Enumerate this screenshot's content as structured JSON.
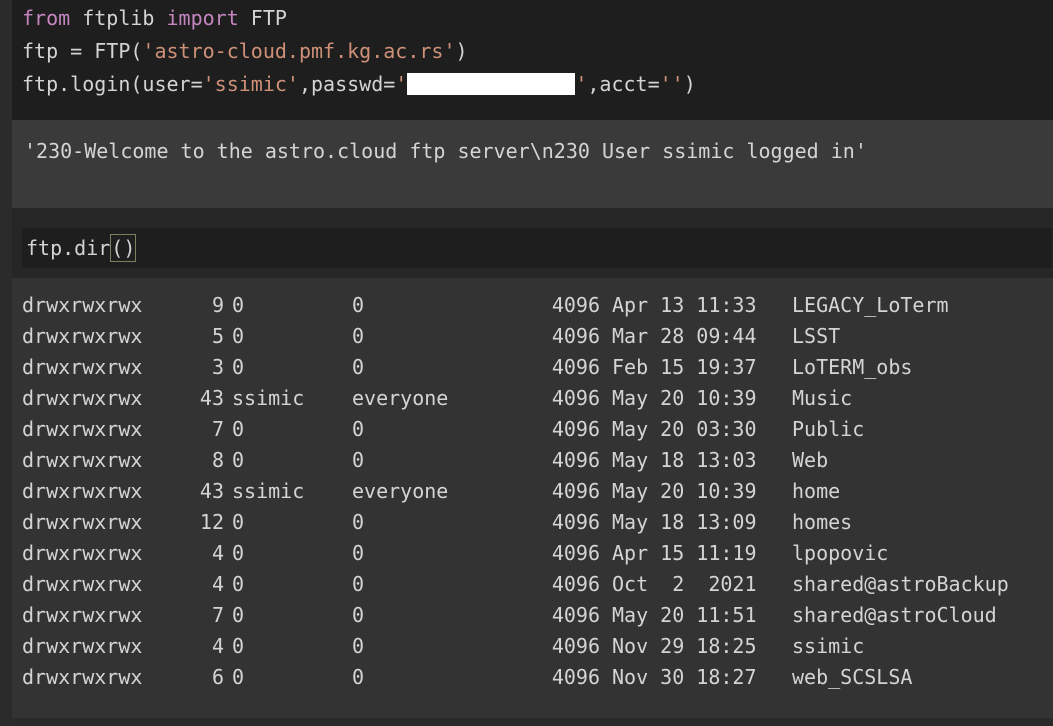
{
  "cell1": {
    "line1": {
      "kw_from": "from",
      "module": " ftplib ",
      "kw_import": "import",
      "name": " FTP"
    },
    "line2": {
      "lhs": "ftp = FTP(",
      "str": "'astro-cloud.pmf.kg.ac.rs'",
      "rhs": ")"
    },
    "line3": {
      "call": "ftp.login(user=",
      "user": "'ssimic'",
      "mid": ",passwd=",
      "pwd_open": "'",
      "pwd_close": "'",
      "tail": ",acct=",
      "acct": "''",
      "end": ")"
    }
  },
  "output1": {
    "text": "'230-Welcome to the astro.cloud ftp server\\n230 User ssimic logged in'"
  },
  "cell2": {
    "code_pre": "ftp.dir",
    "code_parens": "()"
  },
  "dir_listing": [
    {
      "perm": "drwxrwxrwx",
      "links": "9",
      "owner": "0",
      "group": "0",
      "size": "4096",
      "date": "Apr 13 11:33",
      "name": "LEGACY_LoTerm"
    },
    {
      "perm": "drwxrwxrwx",
      "links": "5",
      "owner": "0",
      "group": "0",
      "size": "4096",
      "date": "Mar 28 09:44",
      "name": "LSST"
    },
    {
      "perm": "drwxrwxrwx",
      "links": "3",
      "owner": "0",
      "group": "0",
      "size": "4096",
      "date": "Feb 15 19:37",
      "name": "LoTERM_obs"
    },
    {
      "perm": "drwxrwxrwx",
      "links": "43",
      "owner": "ssimic",
      "group": "everyone",
      "size": "4096",
      "date": "May 20 10:39",
      "name": "Music"
    },
    {
      "perm": "drwxrwxrwx",
      "links": "7",
      "owner": "0",
      "group": "0",
      "size": "4096",
      "date": "May 20 03:30",
      "name": "Public"
    },
    {
      "perm": "drwxrwxrwx",
      "links": "8",
      "owner": "0",
      "group": "0",
      "size": "4096",
      "date": "May 18 13:03",
      "name": "Web"
    },
    {
      "perm": "drwxrwxrwx",
      "links": "43",
      "owner": "ssimic",
      "group": "everyone",
      "size": "4096",
      "date": "May 20 10:39",
      "name": "home"
    },
    {
      "perm": "drwxrwxrwx",
      "links": "12",
      "owner": "0",
      "group": "0",
      "size": "4096",
      "date": "May 18 13:09",
      "name": "homes"
    },
    {
      "perm": "drwxrwxrwx",
      "links": "4",
      "owner": "0",
      "group": "0",
      "size": "4096",
      "date": "Apr 15 11:19",
      "name": "lpopovic"
    },
    {
      "perm": "drwxrwxrwx",
      "links": "4",
      "owner": "0",
      "group": "0",
      "size": "4096",
      "date": "Oct  2  2021",
      "name": "shared@astroBackup"
    },
    {
      "perm": "drwxrwxrwx",
      "links": "7",
      "owner": "0",
      "group": "0",
      "size": "4096",
      "date": "May 20 11:51",
      "name": "shared@astroCloud"
    },
    {
      "perm": "drwxrwxrwx",
      "links": "4",
      "owner": "0",
      "group": "0",
      "size": "4096",
      "date": "Nov 29 18:25",
      "name": "ssimic"
    },
    {
      "perm": "drwxrwxrwx",
      "links": "6",
      "owner": "0",
      "group": "0",
      "size": "4096",
      "date": "Nov 30 18:27",
      "name": "web_SCSLSA"
    }
  ],
  "colors": {
    "keyword": "#c586c0",
    "string": "#ce9178",
    "text": "#d4d4d4",
    "cell_bg": "#1e1e1e",
    "output_bg": "#333333"
  }
}
